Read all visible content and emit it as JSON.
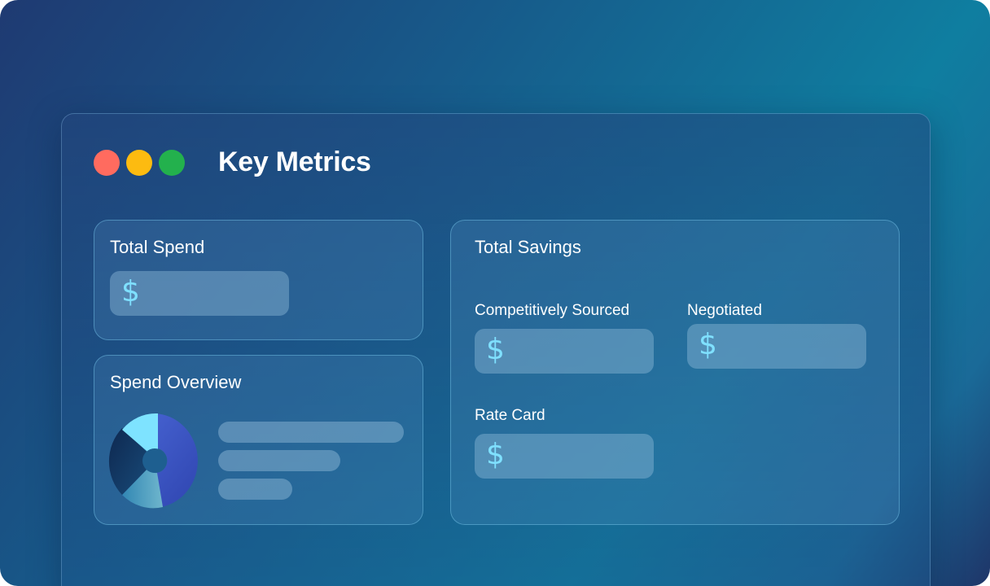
{
  "window": {
    "title": "Key Metrics",
    "controls": [
      {
        "name": "close",
        "color": "#ff6b5f"
      },
      {
        "name": "minimize",
        "color": "#fdbb10"
      },
      {
        "name": "maximize",
        "color": "#23b14d"
      }
    ]
  },
  "total_spend": {
    "title": "Total Spend",
    "currency_symbol": "$"
  },
  "spend_overview": {
    "title": "Spend Overview",
    "chart_icon": "donut-chart-icon"
  },
  "total_savings": {
    "title": "Total Savings",
    "competitively_sourced": {
      "label": "Competitively Sourced",
      "currency_symbol": "$"
    },
    "negotiated": {
      "label": "Negotiated",
      "currency_symbol": "$"
    },
    "rate_card": {
      "label": "Rate Card",
      "currency_symbol": "$"
    }
  },
  "colors": {
    "accent_cyan": "#7fe0ff",
    "donut_blue": "#3b55c8",
    "donut_navy": "#12325e",
    "donut_teal": "#5fb6c8"
  }
}
